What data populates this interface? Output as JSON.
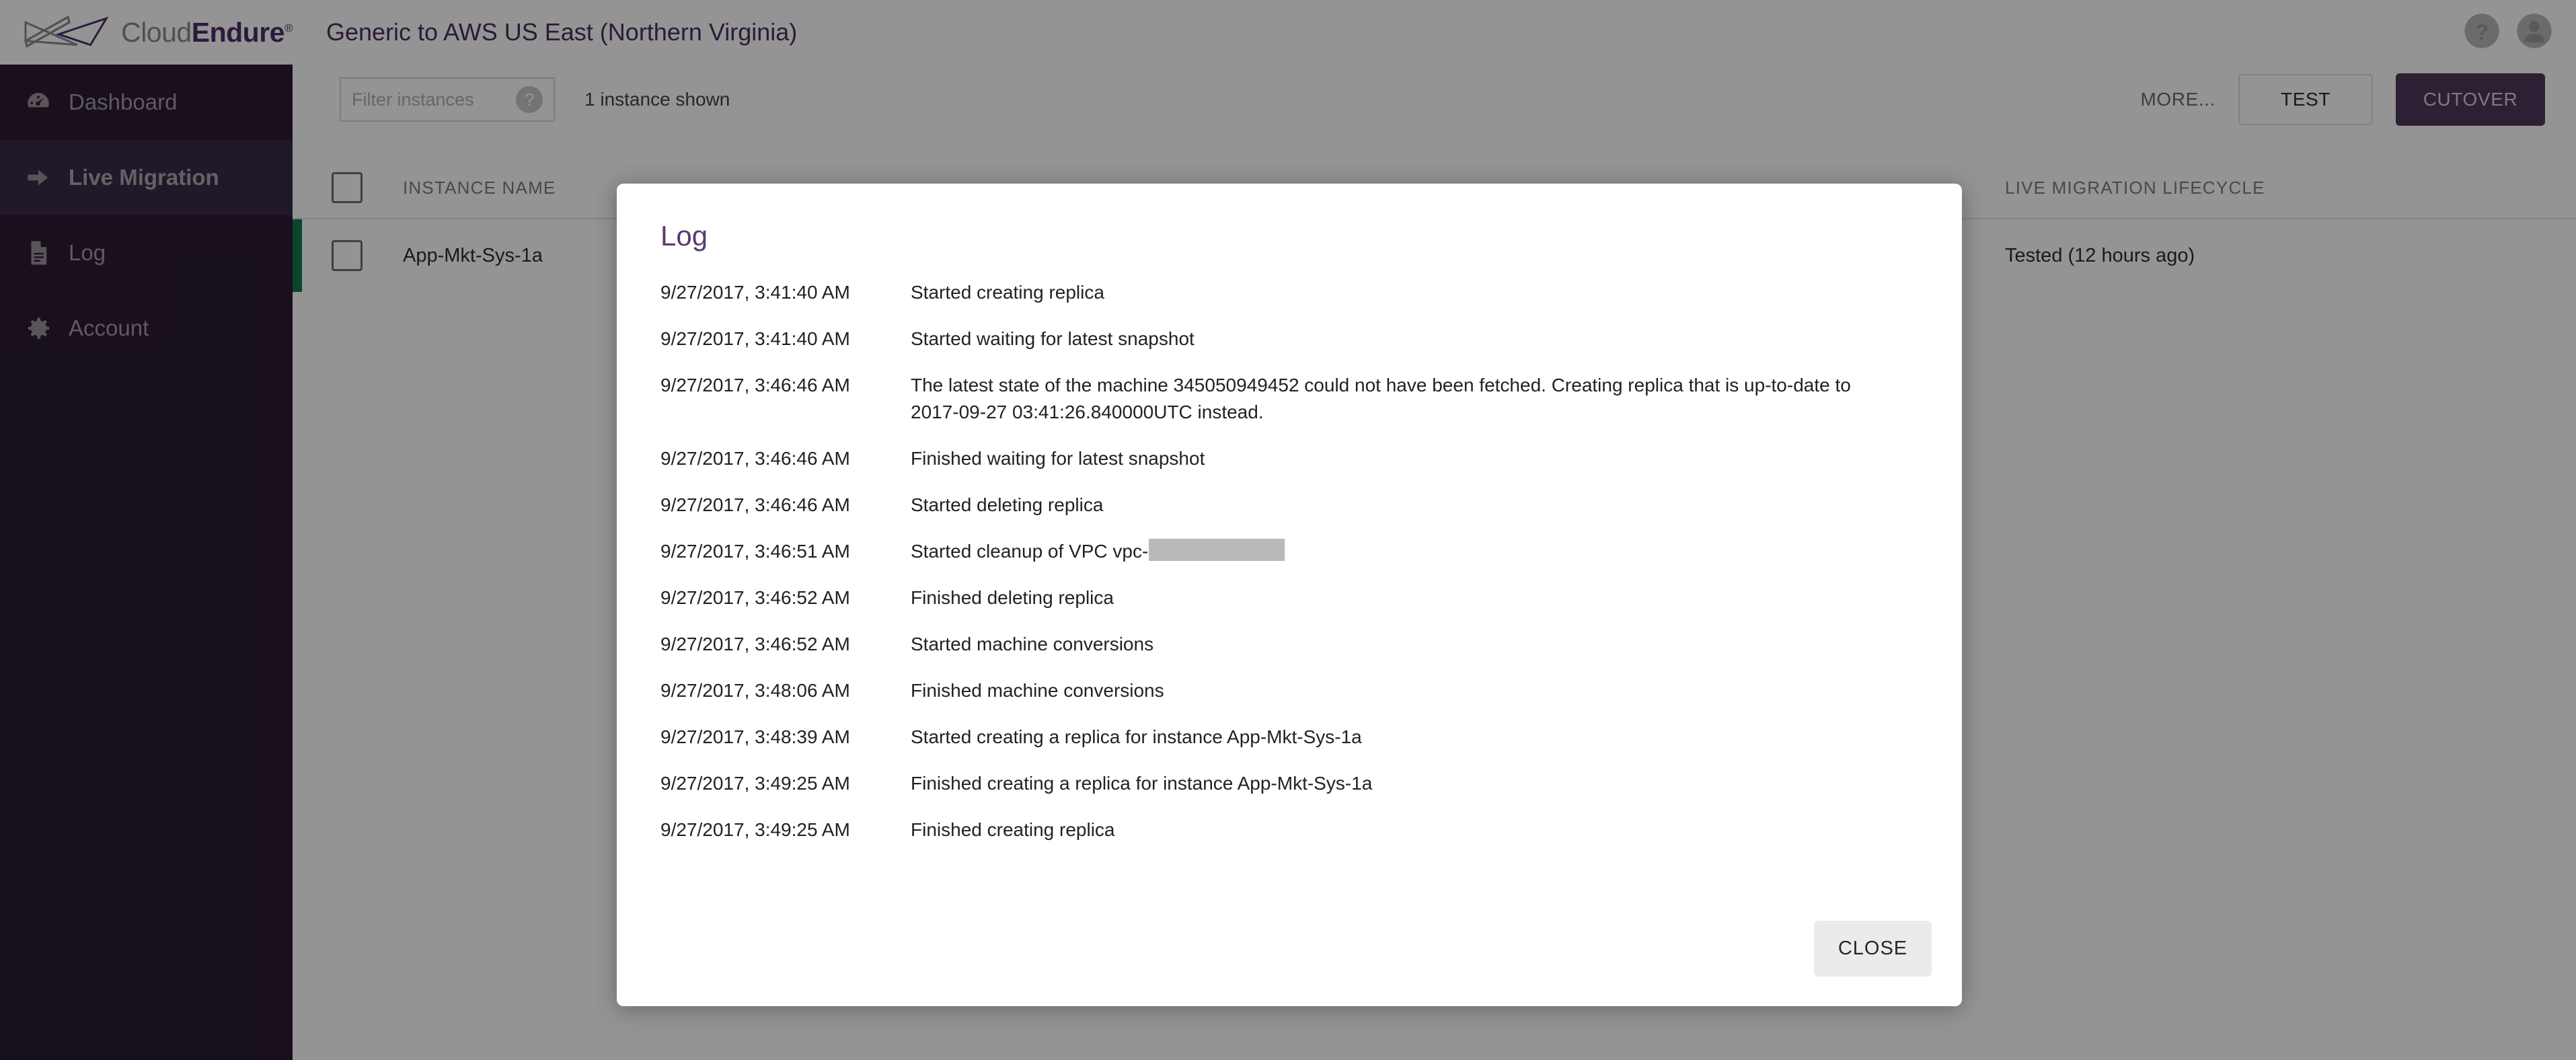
{
  "brand": {
    "cloud": "Cloud",
    "endure": "Endure",
    "registered": "®",
    "logo_icon": "bowtie-logo-icon"
  },
  "header": {
    "title": "Generic to AWS US East (Northern Virginia)",
    "help_icon": "help-circle-icon",
    "account_icon": "user-avatar-icon"
  },
  "sidebar": {
    "items": [
      {
        "label": "Dashboard",
        "icon": "gauge-icon",
        "active": false
      },
      {
        "label": "Live Migration",
        "icon": "arrow-right-icon",
        "active": true
      },
      {
        "label": "Log",
        "icon": "document-icon",
        "active": false
      },
      {
        "label": "Account",
        "icon": "gear-icon",
        "active": false
      }
    ]
  },
  "toolbar": {
    "filter_placeholder": "Filter instances",
    "filter_value": "",
    "help_badge": "?",
    "instances_shown": "1 instance shown",
    "more_label": "MORE...",
    "test_label": "TEST",
    "cutover_label": "CUTOVER"
  },
  "table": {
    "columns": {
      "instance_name": "INSTANCE NAME",
      "lifecycle": "LIVE MIGRATION LIFECYCLE"
    },
    "rows": [
      {
        "instance_name": "App-Mkt-Sys-1a",
        "lifecycle": "Tested (12 hours ago)",
        "status_color": "#14784c",
        "selected": false
      }
    ]
  },
  "dialog": {
    "title": "Log",
    "close_label": "CLOSE",
    "entries": [
      {
        "timestamp": "9/27/2017, 3:41:40 AM",
        "message": "Started creating replica"
      },
      {
        "timestamp": "9/27/2017, 3:41:40 AM",
        "message": "Started waiting for latest snapshot"
      },
      {
        "timestamp": "9/27/2017, 3:46:46 AM",
        "message": "The latest state of the machine 345050949452 could not have been fetched. Creating replica that is up-to-date to 2017-09-27 03:41:26.840000UTC instead."
      },
      {
        "timestamp": "9/27/2017, 3:46:46 AM",
        "message": "Finished waiting for latest snapshot"
      },
      {
        "timestamp": "9/27/2017, 3:46:46 AM",
        "message": "Started deleting replica"
      },
      {
        "timestamp": "9/27/2017, 3:46:51 AM",
        "message": "Started cleanup of VPC vpc-",
        "redacted": true
      },
      {
        "timestamp": "9/27/2017, 3:46:52 AM",
        "message": "Finished deleting replica"
      },
      {
        "timestamp": "9/27/2017, 3:46:52 AM",
        "message": "Started machine conversions"
      },
      {
        "timestamp": "9/27/2017, 3:48:06 AM",
        "message": "Finished machine conversions"
      },
      {
        "timestamp": "9/27/2017, 3:48:39 AM",
        "message": "Started creating a replica for instance App-Mkt-Sys-1a"
      },
      {
        "timestamp": "9/27/2017, 3:49:25 AM",
        "message": "Finished creating a replica for instance App-Mkt-Sys-1a"
      },
      {
        "timestamp": "9/27/2017, 3:49:25 AM",
        "message": "Finished creating replica"
      }
    ]
  },
  "colors": {
    "sidebar_bg": "#2b1b33",
    "sidebar_active": "#3a2b47",
    "brand_purple": "#4b2e6b",
    "dialog_title": "#5a3a72",
    "cutover_bg": "#4c3a5a",
    "status_green": "#14784c"
  }
}
